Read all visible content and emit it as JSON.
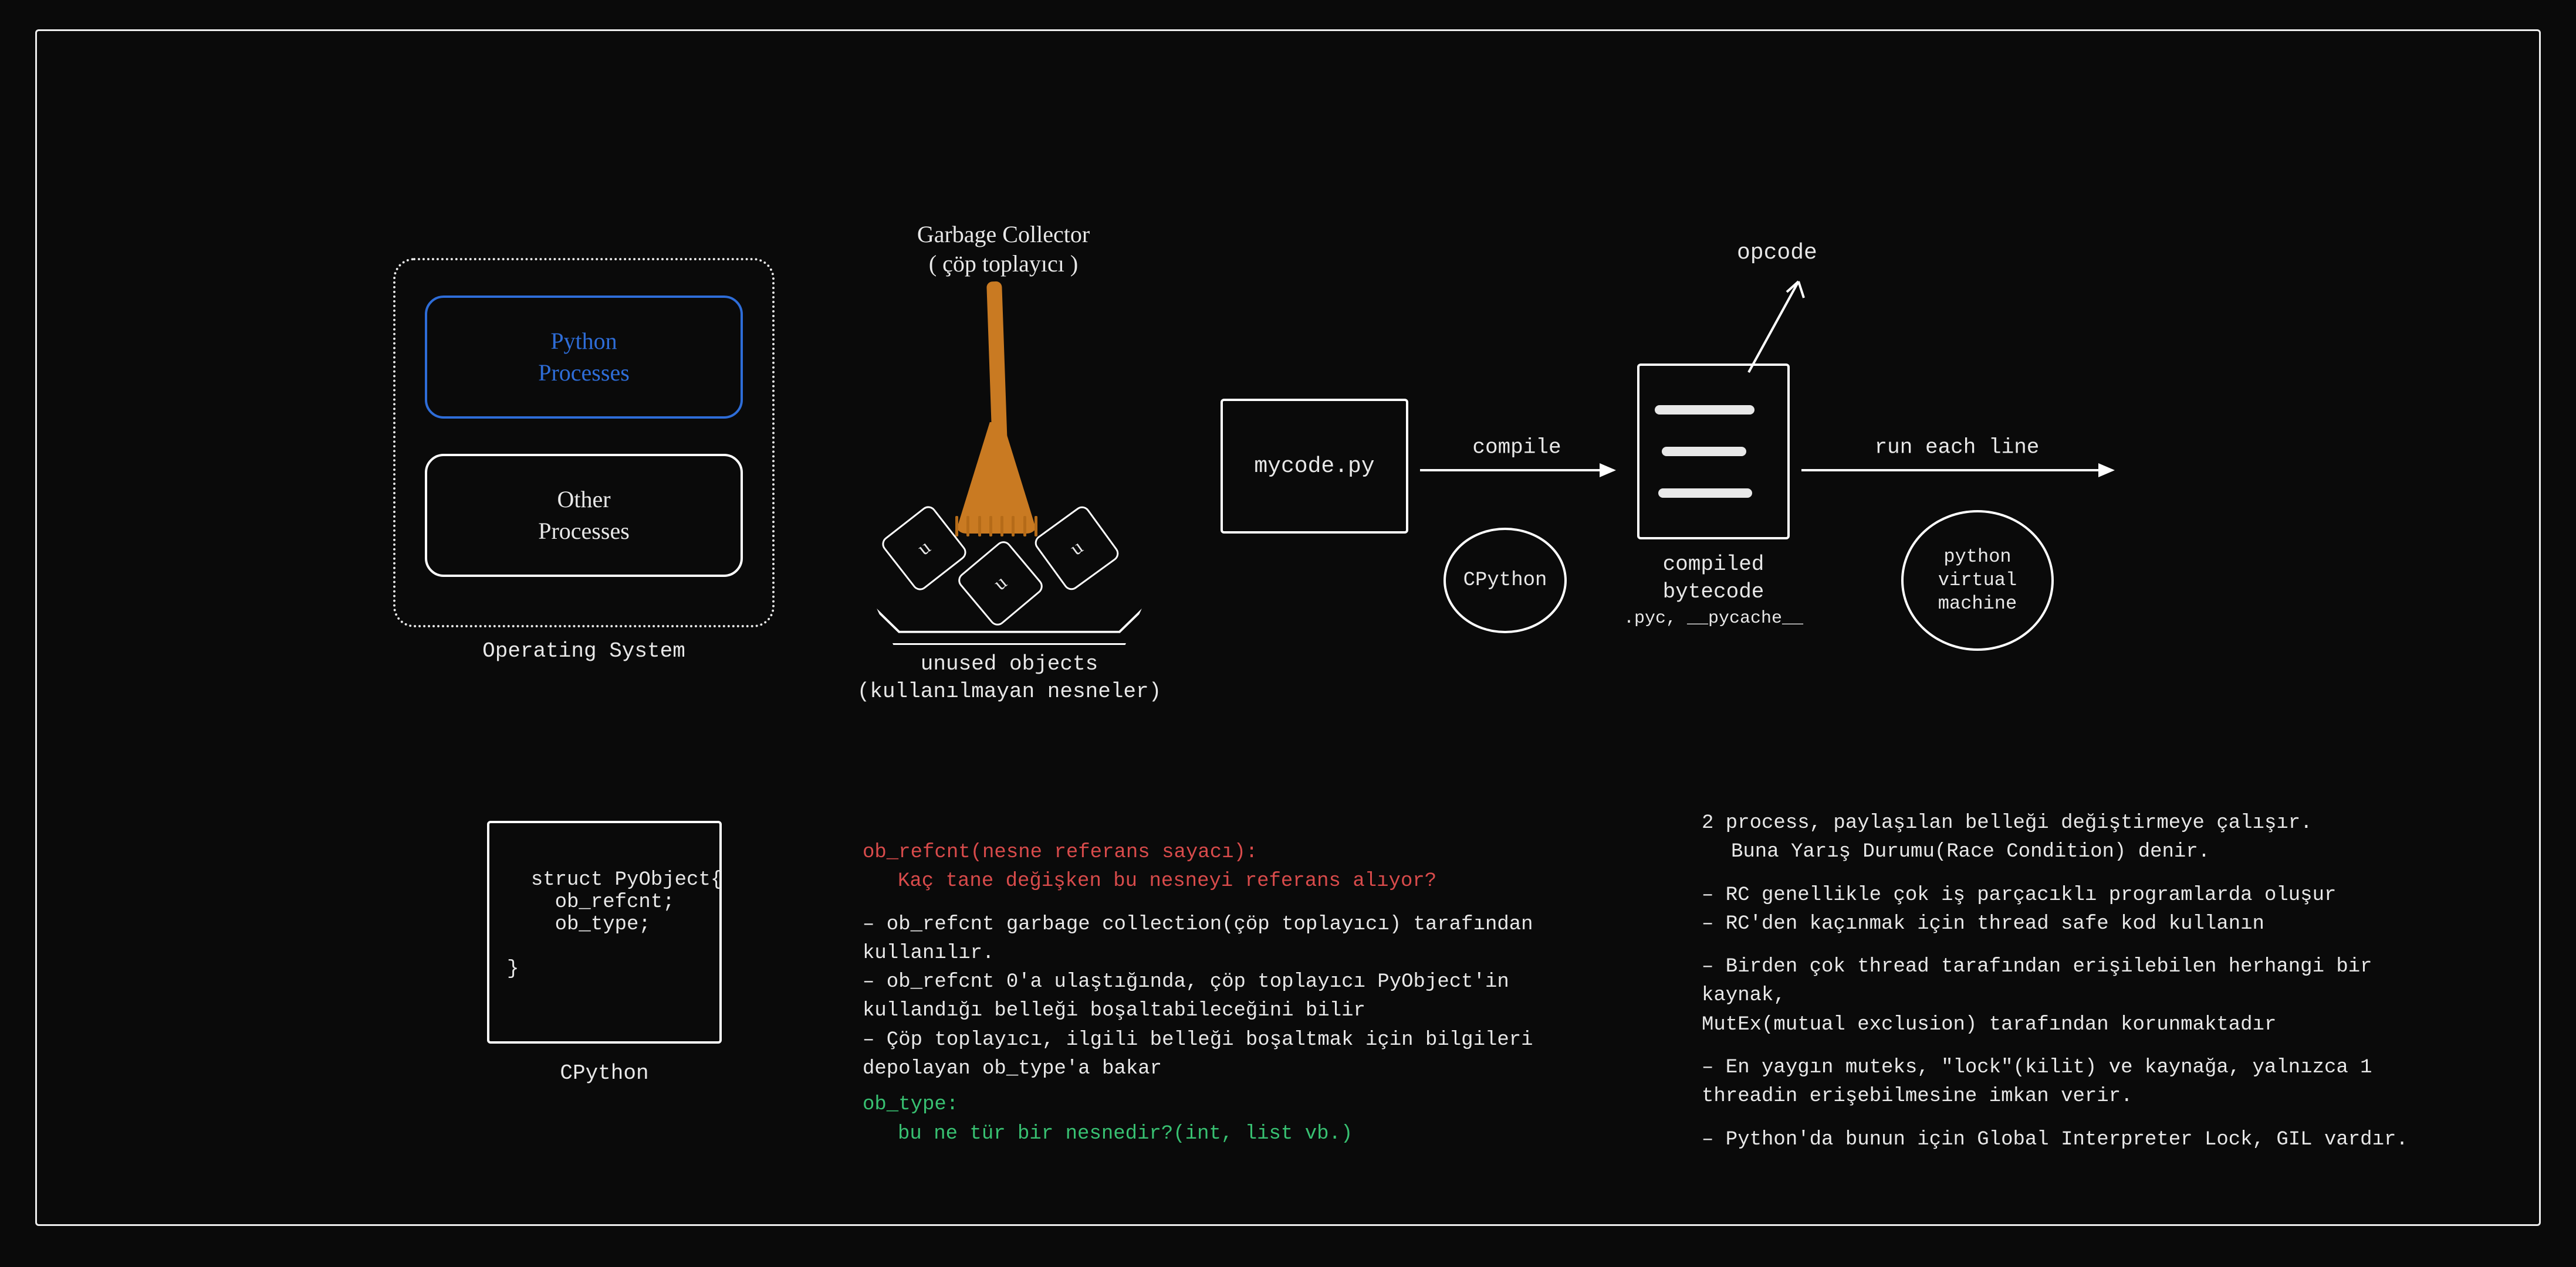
{
  "os": {
    "caption": "Operating System",
    "python": "Python\nProcesses",
    "other": "Other\nProcesses"
  },
  "gc": {
    "title_line1": "Garbage Collector",
    "title_line2": "( çöp toplayıcı )",
    "u1": "u",
    "u2": "u",
    "u3": "u",
    "caption_line1": "unused objects",
    "caption_line2": "(kullanılmayan nesneler)"
  },
  "pipeline": {
    "mycode": "mycode.py",
    "compile": "compile",
    "run": "run each line",
    "opcode": "opcode",
    "bytecode_caption1": "compiled",
    "bytecode_caption2": "bytecode",
    "bytecode_sub": ".pyc, __pycache__",
    "cpython": "CPython",
    "pvm": "python\nvirtual\nmachine"
  },
  "struct": {
    "code": "struct PyObject{\n    ob_refcnt;\n    ob_type;\n\n}",
    "caption": "CPython"
  },
  "refcnt": {
    "h1": "ob_refcnt(nesne referans sayacı):",
    "h1b": "Kaç tane değişken bu nesneyi referans alıyor?",
    "p1": "– ob_refcnt garbage collection(çöp toplayıcı) tarafından kullanılır.",
    "p2": "– ob_refcnt 0'a ulaştığında, çöp toplayıcı PyObject'in kullandığı belleği boşaltabileceğini bilir",
    "p3": "– Çöp toplayıcı, ilgili belleği boşaltmak için bilgileri depolayan ob_type'a bakar",
    "h2": "ob_type:",
    "h2b": "bu ne tür bir nesnedir?(int, list vb.)"
  },
  "rc": {
    "l1": "2 process, paylaşılan belleği değiştirmeye çalışır.",
    "l1b": "Buna Yarış Durumu(Race Condition) denir.",
    "l2": "– RC genellikle çok iş parçacıklı programlarda oluşur",
    "l3": "– RC'den kaçınmak için thread safe kod kullanın",
    "l4": "– Birden çok thread tarafından erişilebilen herhangi bir kaynak,",
    "l4b": "MutEx(mutual exclusion) tarafından korunmaktadır",
    "l5": "– En yaygın muteks, \"lock\"(kilit) ve kaynağa, yalnızca 1 threadin erişebilmesine imkan verir.",
    "l6": "– Python'da bunun için Global Interpreter Lock, GIL vardır."
  }
}
